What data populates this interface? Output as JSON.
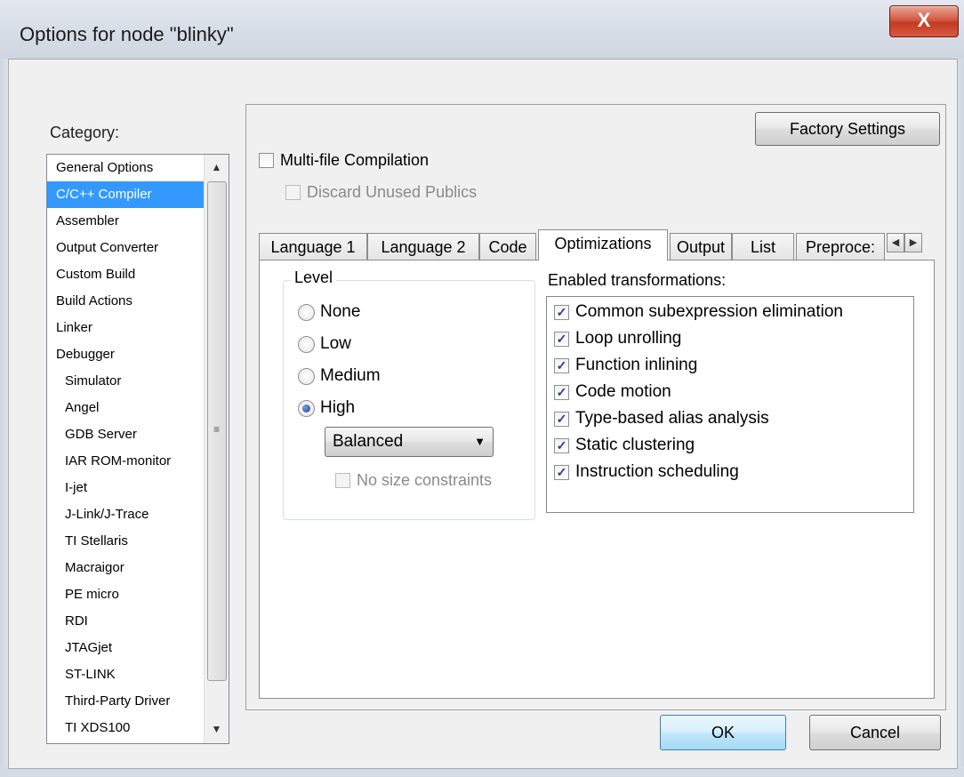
{
  "window": {
    "title": "Options for node \"blinky\"",
    "close_glyph": "X"
  },
  "category": {
    "label": "Category:",
    "items": [
      {
        "label": "General Options",
        "indent": false,
        "selected": false
      },
      {
        "label": "C/C++ Compiler",
        "indent": false,
        "selected": true
      },
      {
        "label": "Assembler",
        "indent": false,
        "selected": false
      },
      {
        "label": "Output Converter",
        "indent": false,
        "selected": false
      },
      {
        "label": "Custom Build",
        "indent": false,
        "selected": false
      },
      {
        "label": "Build Actions",
        "indent": false,
        "selected": false
      },
      {
        "label": "Linker",
        "indent": false,
        "selected": false
      },
      {
        "label": "Debugger",
        "indent": false,
        "selected": false
      },
      {
        "label": "Simulator",
        "indent": true,
        "selected": false
      },
      {
        "label": "Angel",
        "indent": true,
        "selected": false
      },
      {
        "label": "GDB Server",
        "indent": true,
        "selected": false
      },
      {
        "label": "IAR ROM-monitor",
        "indent": true,
        "selected": false
      },
      {
        "label": "I-jet",
        "indent": true,
        "selected": false
      },
      {
        "label": "J-Link/J-Trace",
        "indent": true,
        "selected": false
      },
      {
        "label": "TI Stellaris",
        "indent": true,
        "selected": false
      },
      {
        "label": "Macraigor",
        "indent": true,
        "selected": false
      },
      {
        "label": "PE micro",
        "indent": true,
        "selected": false
      },
      {
        "label": "RDI",
        "indent": true,
        "selected": false
      },
      {
        "label": "JTAGjet",
        "indent": true,
        "selected": false
      },
      {
        "label": "ST-LINK",
        "indent": true,
        "selected": false
      },
      {
        "label": "Third-Party Driver",
        "indent": true,
        "selected": false
      },
      {
        "label": "TI XDS100",
        "indent": true,
        "selected": false
      }
    ]
  },
  "buttons": {
    "factory": "Factory Settings",
    "ok": "OK",
    "cancel": "Cancel"
  },
  "options": {
    "multifile": {
      "label": "Multi-file Compilation",
      "checked": false
    },
    "discard": {
      "label": "Discard Unused Publics",
      "checked": false,
      "enabled": false
    }
  },
  "tabs": [
    {
      "label": "Language 1",
      "active": false
    },
    {
      "label": "Language 2",
      "active": false
    },
    {
      "label": "Code",
      "active": false
    },
    {
      "label": "Optimizations",
      "active": true
    },
    {
      "label": "Output",
      "active": false
    },
    {
      "label": "List",
      "active": false
    },
    {
      "label": "Preproce:",
      "active": false
    }
  ],
  "level": {
    "legend": "Level",
    "options": [
      "None",
      "Low",
      "Medium",
      "High"
    ],
    "selected": "High",
    "strategy": "Balanced",
    "no_size_constraints": {
      "label": "No size constraints",
      "checked": false,
      "enabled": false
    }
  },
  "transformations": {
    "label": "Enabled transformations:",
    "items": [
      {
        "label": "Common subexpression elimination",
        "checked": true
      },
      {
        "label": "Loop unrolling",
        "checked": true
      },
      {
        "label": "Function inlining",
        "checked": true
      },
      {
        "label": "Code motion",
        "checked": true
      },
      {
        "label": "Type-based alias analysis",
        "checked": true
      },
      {
        "label": "Static clustering",
        "checked": true
      },
      {
        "label": "Instruction scheduling",
        "checked": true
      }
    ]
  },
  "icons": {
    "close": "close-icon",
    "scroll_up": "scroll-up-icon",
    "scroll_down": "scroll-down-icon",
    "tab_left": "tab-scroll-left-icon",
    "tab_right": "tab-scroll-right-icon",
    "dropdown": "chevron-down-icon"
  },
  "colors": {
    "selection": "#3399ff",
    "close_button": "#c23b24",
    "check_mark": "#2a3e8f"
  }
}
